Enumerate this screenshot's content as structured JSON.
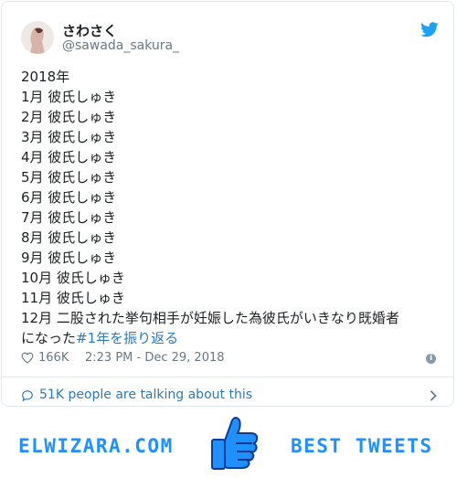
{
  "tweet": {
    "display_name": "さわさく",
    "handle": "@sawada_sakura_",
    "lines": [
      "2018年",
      "1月 彼氏しゅき",
      "2月 彼氏しゅき",
      "3月 彼氏しゅき",
      "4月 彼氏しゅき",
      "5月 彼氏しゅき",
      "6月 彼氏しゅき",
      "7月 彼氏しゅき",
      "8月 彼氏しゅき",
      "9月 彼氏しゅき",
      "10月 彼氏しゅき",
      "11月 彼氏しゅき",
      "12月 二股された挙句相手が妊娠した為彼氏がいきなり既婚者"
    ],
    "last_line_prefix": "になった",
    "hashtag": "#1年を振り返る",
    "likes": "166K",
    "timestamp": "2:23 PM - Dec 29, 2018",
    "talking": "51K people are talking about this"
  },
  "footer": {
    "brand": "ELWIZARA.COM",
    "tagline": "BEST TWEETS"
  },
  "colors": {
    "accent": "#1da1f2",
    "link": "#2b7bb9",
    "brand": "#1e90ff"
  }
}
